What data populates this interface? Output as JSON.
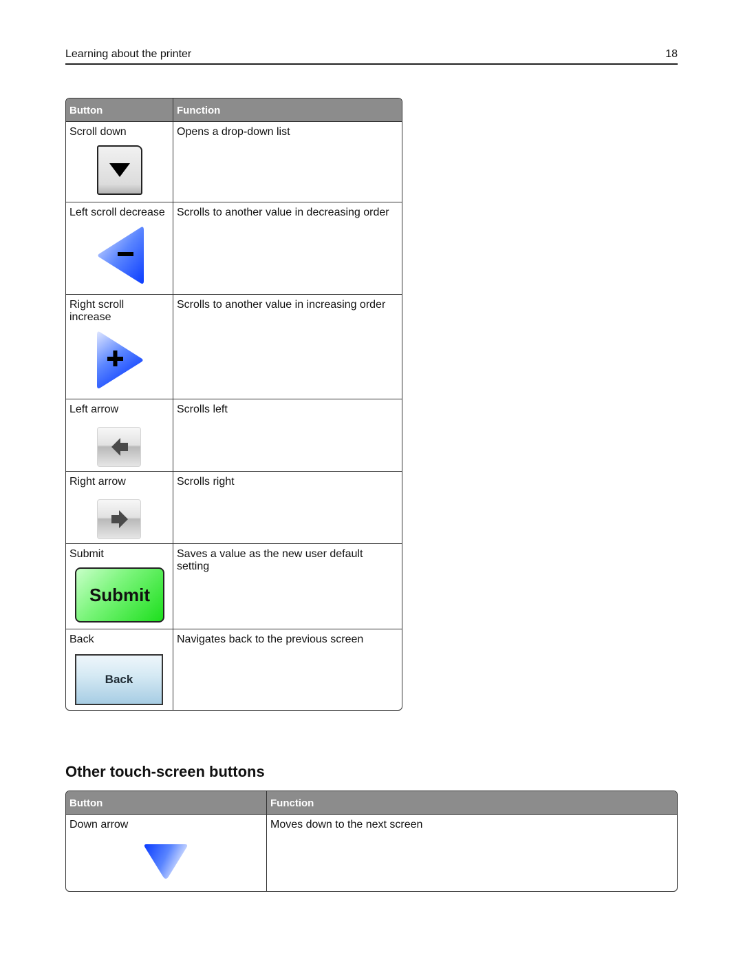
{
  "header": {
    "title": "Learning about the printer",
    "page_number": "18"
  },
  "table1": {
    "columns": [
      "Button",
      "Function"
    ],
    "rows": [
      {
        "button": "Scroll down",
        "function": "Opens a drop-down list",
        "icon": "scroll-down-icon"
      },
      {
        "button": "Left scroll decrease",
        "function": "Scrolls to another value in decreasing order",
        "icon": "left-scroll-decrease-icon"
      },
      {
        "button": "Right scroll increase",
        "function": "Scrolls to another value in increasing order",
        "icon": "right-scroll-increase-icon"
      },
      {
        "button": "Left arrow",
        "function": "Scrolls left",
        "icon": "left-arrow-icon"
      },
      {
        "button": "Right arrow",
        "function": "Scrolls right",
        "icon": "right-arrow-icon"
      },
      {
        "button": "Submit",
        "function": "Saves a value as the new user default setting",
        "icon": "submit-button-image",
        "icon_text": "Submit"
      },
      {
        "button": "Back",
        "function": "Navigates back to the previous screen",
        "icon": "back-button-image",
        "icon_text": "Back"
      }
    ]
  },
  "section2": {
    "heading": "Other touch-screen buttons"
  },
  "table2": {
    "columns": [
      "Button",
      "Function"
    ],
    "rows": [
      {
        "button": "Down arrow",
        "function": "Moves down to the next screen",
        "icon": "down-arrow-icon"
      }
    ]
  },
  "colors": {
    "header_fill": "#8c8c8c",
    "blue_icon": "#0a46ff",
    "submit_green": "#1ddf1d",
    "back_blue": "#a7cde4"
  }
}
